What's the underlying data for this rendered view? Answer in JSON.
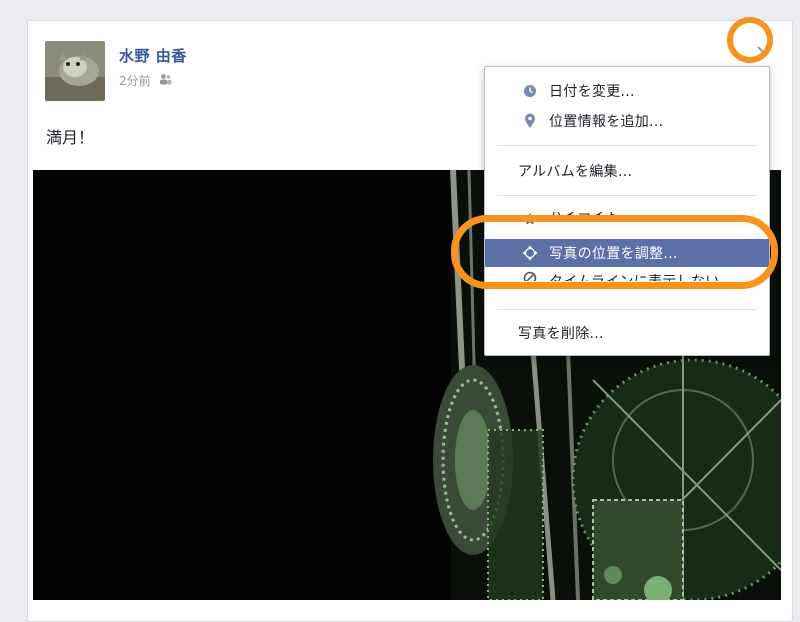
{
  "post": {
    "author": "水野 由香",
    "timestamp": "2分前",
    "audience_icon": "friends-icon",
    "text": "満月！",
    "avatar_icon": "cat-avatar",
    "options_icon": "chevron-down-icon"
  },
  "menu": {
    "items": [
      {
        "label": "日付を変更...",
        "icon": "clock-icon"
      },
      {
        "label": "位置情報を追加...",
        "icon": "pin-icon"
      },
      {
        "label": "アルバムを編集..."
      },
      {
        "label": "ハイライト",
        "icon": "star-icon"
      },
      {
        "label": "写真の位置を調整...",
        "icon": "move-icon"
      },
      {
        "label": "タイムラインに表示しない",
        "icon": "hide-icon"
      },
      {
        "label": "写真を削除..."
      }
    ]
  },
  "colors": {
    "highlight_ring": "#f7931e",
    "menu_highlight": "#5b70a7",
    "author_link": "#365899"
  }
}
